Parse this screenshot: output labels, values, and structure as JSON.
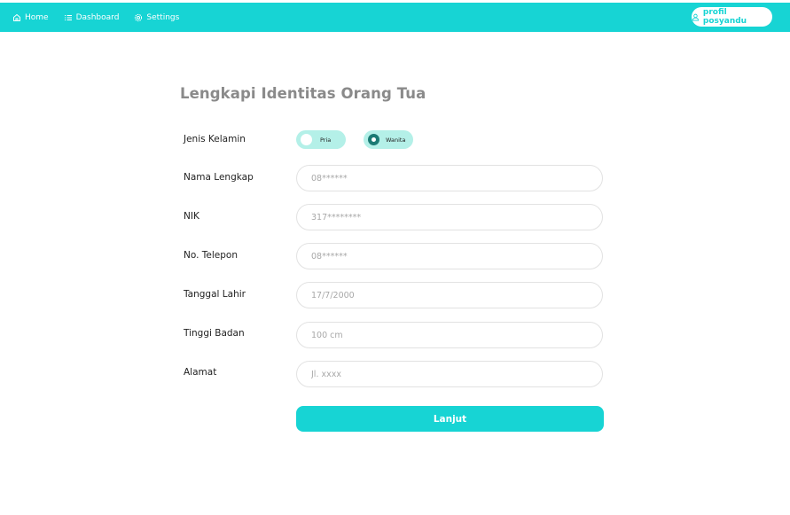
{
  "nav": {
    "home": "Home",
    "dashboard": "Dashboard",
    "settings": "Settings",
    "profile": "profil posyandu"
  },
  "form": {
    "title": "Lengkapi Identitas Orang Tua",
    "gender": {
      "label": "Jenis Kelamin",
      "options": [
        "Pria",
        "Wanita"
      ],
      "selected": "Wanita"
    },
    "full_name": {
      "label": "Nama Lengkap",
      "placeholder": "08******"
    },
    "nik": {
      "label": "NIK",
      "placeholder": "317********"
    },
    "phone": {
      "label": "No. Telepon",
      "placeholder": "08******"
    },
    "birth_date": {
      "label": "Tanggal Lahir",
      "placeholder": "17/7/2000"
    },
    "height": {
      "label": "Tinggi Badan",
      "placeholder": "100 cm"
    },
    "address": {
      "label": "Alamat",
      "placeholder": "Jl. xxxx"
    },
    "submit_label": "Lanjut"
  },
  "colors": {
    "accent": "#17d4d4",
    "pill_bg": "#b4f0e8",
    "radio_selected": "#1b7a74",
    "title_gray": "#8a8a8a"
  },
  "icons": {
    "home": "home-icon",
    "dashboard": "list-icon",
    "settings": "gear-icon",
    "profile": "user-icon"
  }
}
